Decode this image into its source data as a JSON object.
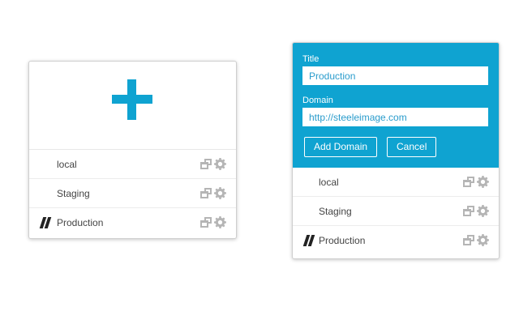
{
  "accent_color": "#0fa3d1",
  "left_panel": {
    "add_icon": "plus-icon",
    "environments": [
      {
        "label": "local",
        "active": false,
        "actions": [
          "window-icon",
          "gear-icon"
        ]
      },
      {
        "label": "Staging",
        "active": false,
        "actions": [
          "window-icon",
          "gear-icon"
        ]
      },
      {
        "label": "Production",
        "active": true,
        "actions": [
          "window-icon",
          "gear-icon"
        ]
      }
    ]
  },
  "right_panel": {
    "form": {
      "title_label": "Title",
      "title_value": "Production",
      "domain_label": "Domain",
      "domain_value": "http://steeleimage.com",
      "add_domain_button": "Add Domain",
      "cancel_button": "Cancel"
    },
    "environments": [
      {
        "label": "local",
        "active": false,
        "actions": [
          "window-icon",
          "gear-icon"
        ]
      },
      {
        "label": "Staging",
        "active": false,
        "actions": [
          "window-icon",
          "gear-icon"
        ]
      },
      {
        "label": "Production",
        "active": true,
        "actions": [
          "window-icon",
          "gear-icon"
        ]
      }
    ]
  }
}
